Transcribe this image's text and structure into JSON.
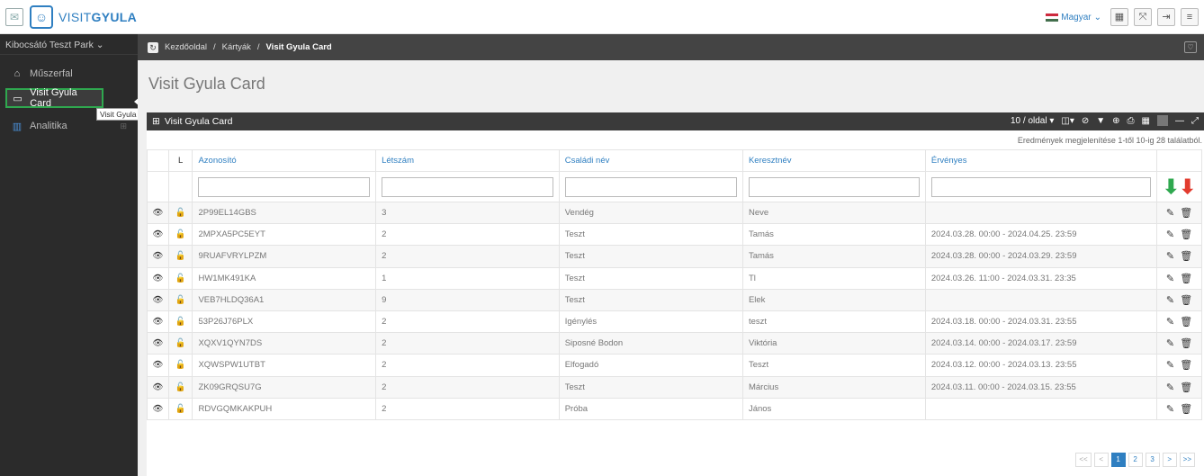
{
  "header": {
    "logo_prefix": "VISIT",
    "logo_bold": "GYULA",
    "language": "Magyar",
    "language_caret": "⌄"
  },
  "sidebar": {
    "park": "Kibocsátó Teszt Park",
    "park_caret": "⌄",
    "items": [
      {
        "label": "Műszerfal",
        "icon": "home-icon"
      },
      {
        "label": "Visit Gyula Card",
        "icon": "card-icon"
      },
      {
        "label": "Analitika",
        "icon": "bar-chart-icon"
      }
    ],
    "tooltip": "Visit Gyula Card"
  },
  "breadcrumb": {
    "home": "Kezdőoldal",
    "sep": "/",
    "cards": "Kártyák",
    "current": "Visit Gyula Card"
  },
  "page": {
    "title": "Visit Gyula Card"
  },
  "panel": {
    "title": "Visit Gyula Card",
    "per_page": "10 / oldal",
    "results": "Eredmények megjelenítése 1-től 10-ig 28 találatból."
  },
  "table": {
    "columns": [
      "L",
      "Azonosító",
      "Létszám",
      "Családi név",
      "Keresztnév",
      "Érvényes"
    ],
    "rows": [
      [
        "2P99EL14GBS",
        "3",
        "Vendég",
        "Neve",
        ""
      ],
      [
        "2MPXA5PC5EYT",
        "2",
        "Teszt",
        "Tamás",
        "2024.03.28. 00:00 - 2024.04.25. 23:59"
      ],
      [
        "9RUAFVRYLPZM",
        "2",
        "Teszt",
        "Tamás",
        "2024.03.28. 00:00 - 2024.03.29. 23:59"
      ],
      [
        "HW1MK491KA",
        "1",
        "Teszt",
        "Tl",
        "2024.03.26. 11:00 - 2024.03.31. 23:35"
      ],
      [
        "VEB7HLDQ36A1",
        "9",
        "Teszt",
        "Elek",
        ""
      ],
      [
        "53P26J76PLX",
        "2",
        "Igénylés",
        "teszt",
        "2024.03.18. 00:00 - 2024.03.31. 23:55"
      ],
      [
        "XQXV1QYN7DS",
        "2",
        "Siposné Bodon",
        "Viktória",
        "2024.03.14. 00:00 - 2024.03.17. 23:59"
      ],
      [
        "XQWSPW1UTBT",
        "2",
        "Elfogadó",
        "Teszt",
        "2024.03.12. 00:00 - 2024.03.13. 23:55"
      ],
      [
        "ZK09GRQSU7G",
        "2",
        "Teszt",
        "Március",
        "2024.03.11. 00:00 - 2024.03.15. 23:55"
      ],
      [
        "RDVGQMKAKPUH",
        "2",
        "Próba",
        "János",
        ""
      ]
    ]
  },
  "pagination": [
    "<<",
    "<",
    "1",
    "2",
    "3",
    ">",
    ">>"
  ],
  "colors": {
    "accent": "#2f7fc1",
    "highlight_green": "#2fa84f",
    "arrow_red": "#e23b2e",
    "sidebar_bg": "#2b2b2b"
  }
}
